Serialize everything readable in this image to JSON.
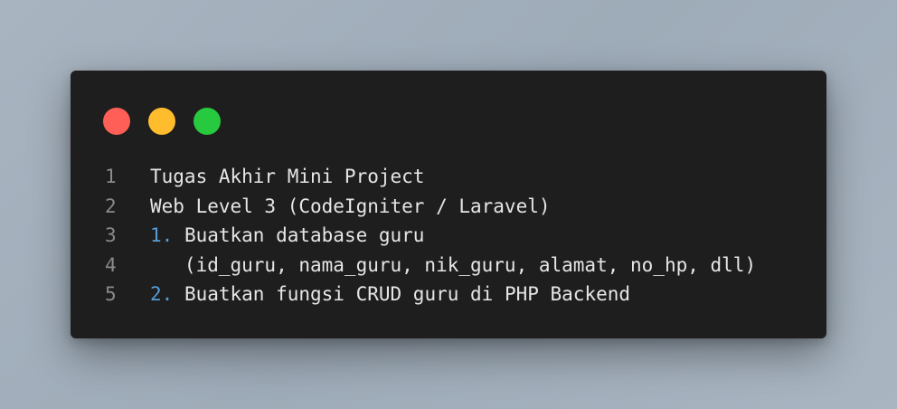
{
  "window": {
    "controls": [
      {
        "name": "close",
        "color": "#ff5f56"
      },
      {
        "name": "minimize",
        "color": "#ffbd2e"
      },
      {
        "name": "zoom",
        "color": "#27c93f"
      }
    ]
  },
  "code": {
    "lines": [
      {
        "number": "1",
        "prefix": "",
        "text": "Tugas Akhir Mini Project"
      },
      {
        "number": "2",
        "prefix": "",
        "text": "Web Level 3 (CodeIgniter / Laravel)"
      },
      {
        "number": "3",
        "prefix": "1.",
        "text": " Buatkan database guru"
      },
      {
        "number": "4",
        "prefix": "",
        "text": "   (id_guru, nama_guru, nik_guru, alamat, no_hp, dll)"
      },
      {
        "number": "5",
        "prefix": "2.",
        "text": " Buatkan fungsi CRUD guru di PHP Backend"
      }
    ]
  },
  "colors": {
    "window_bg": "#1e1e1e",
    "text": "#e6e6e6",
    "line_number": "#8a8a8a",
    "list_number": "#569cd6"
  }
}
